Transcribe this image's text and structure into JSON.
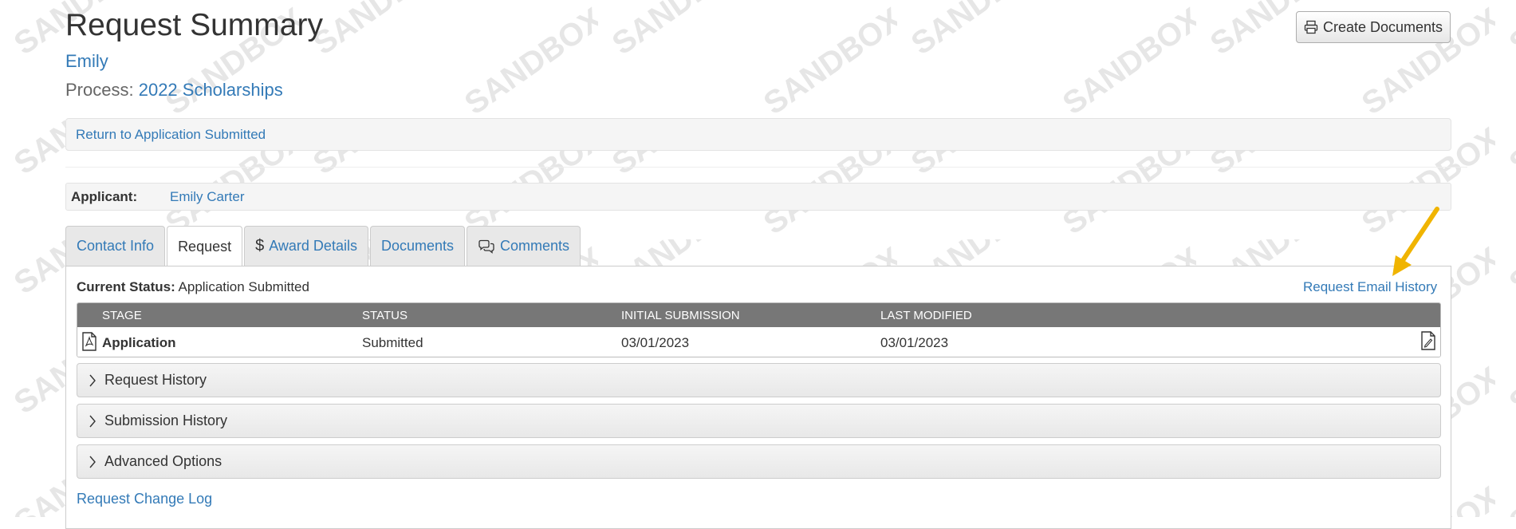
{
  "page": {
    "title": "Request Summary",
    "user_name": "Emily",
    "process_label": "Process:",
    "process_name": "2022 Scholarships",
    "create_documents_label": "Create Documents",
    "return_link": "Return to Application Submitted",
    "watermark_text": "SANDBOX"
  },
  "applicant": {
    "label": "Applicant:",
    "name": "Emily Carter"
  },
  "tabs": [
    {
      "label": "Contact Info",
      "icon": null,
      "active": false
    },
    {
      "label": "Request",
      "icon": null,
      "active": true
    },
    {
      "label": "Award Details",
      "icon": "dollar-icon",
      "active": false
    },
    {
      "label": "Documents",
      "icon": null,
      "active": false
    },
    {
      "label": "Comments",
      "icon": "comments-icon",
      "active": false
    }
  ],
  "status": {
    "label": "Current Status:",
    "value": "Application Submitted",
    "email_history_link": "Request Email History"
  },
  "stage_table": {
    "headers": [
      "STAGE",
      "STATUS",
      "INITIAL SUBMISSION",
      "LAST MODIFIED"
    ],
    "rows": [
      {
        "stage": "Application",
        "status": "Submitted",
        "initial_submission": "03/01/2023",
        "last_modified": "03/01/2023"
      }
    ]
  },
  "accordions": [
    "Request History",
    "Submission History",
    "Advanced Options"
  ],
  "change_log_link": "Request Change Log",
  "colors": {
    "link": "#337ab7",
    "table_header": "#777777",
    "annotation_arrow": "#f0b400"
  }
}
